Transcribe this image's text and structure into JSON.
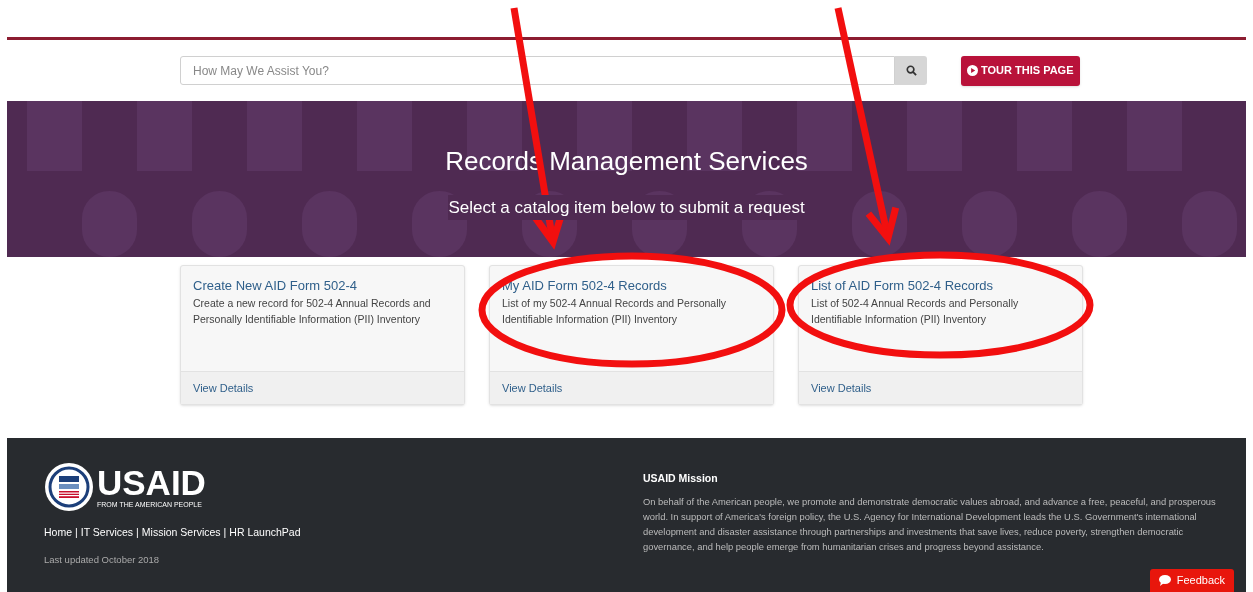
{
  "search": {
    "placeholder": "How May We Assist You?"
  },
  "tour_button": {
    "label": "TOUR THIS PAGE"
  },
  "banner": {
    "title": "Records Management Services",
    "subtitle": "Select a catalog item below to submit a request"
  },
  "cards": [
    {
      "title": "Create New AID Form 502-4",
      "description": "Create a new record for 502-4 Annual Records and Personally Identifiable Information (PII) Inventory",
      "link": "View Details"
    },
    {
      "title": "My AID Form 502-4 Records",
      "description": "List of my 502-4 Annual Records and Personally Identifiable Information (PII) Inventory",
      "link": "View Details"
    },
    {
      "title": "List of AID Form 502-4 Records",
      "description": "List of 502-4 Annual Records and Personally Identifiable Information (PII) Inventory",
      "link": "View Details"
    }
  ],
  "footer": {
    "logo_text": "USAID",
    "logo_tagline": "FROM THE AMERICAN PEOPLE",
    "links": [
      "Home",
      "IT Services",
      "Mission Services",
      "HR LaunchPad"
    ],
    "separator": "|",
    "updated": "Last updated October 2018",
    "mission_title": "USAID Mission",
    "mission_text": "On behalf of the American people, we promote and demonstrate democratic values abroad, and advance a free, peaceful, and prosperous world. In support of America's foreign policy, the U.S. Agency for International Development leads the U.S. Government's international development and disaster assistance through partnerships and investments that save lives, reduce poverty, strengthen democratic governance, and help people emerge from humanitarian crises and progress beyond assistance."
  },
  "feedback_button": {
    "label": "Feedback"
  },
  "annotations": [
    {
      "kind": "arrow"
    },
    {
      "kind": "arrow"
    },
    {
      "kind": "ellipse"
    },
    {
      "kind": "ellipse"
    }
  ]
}
